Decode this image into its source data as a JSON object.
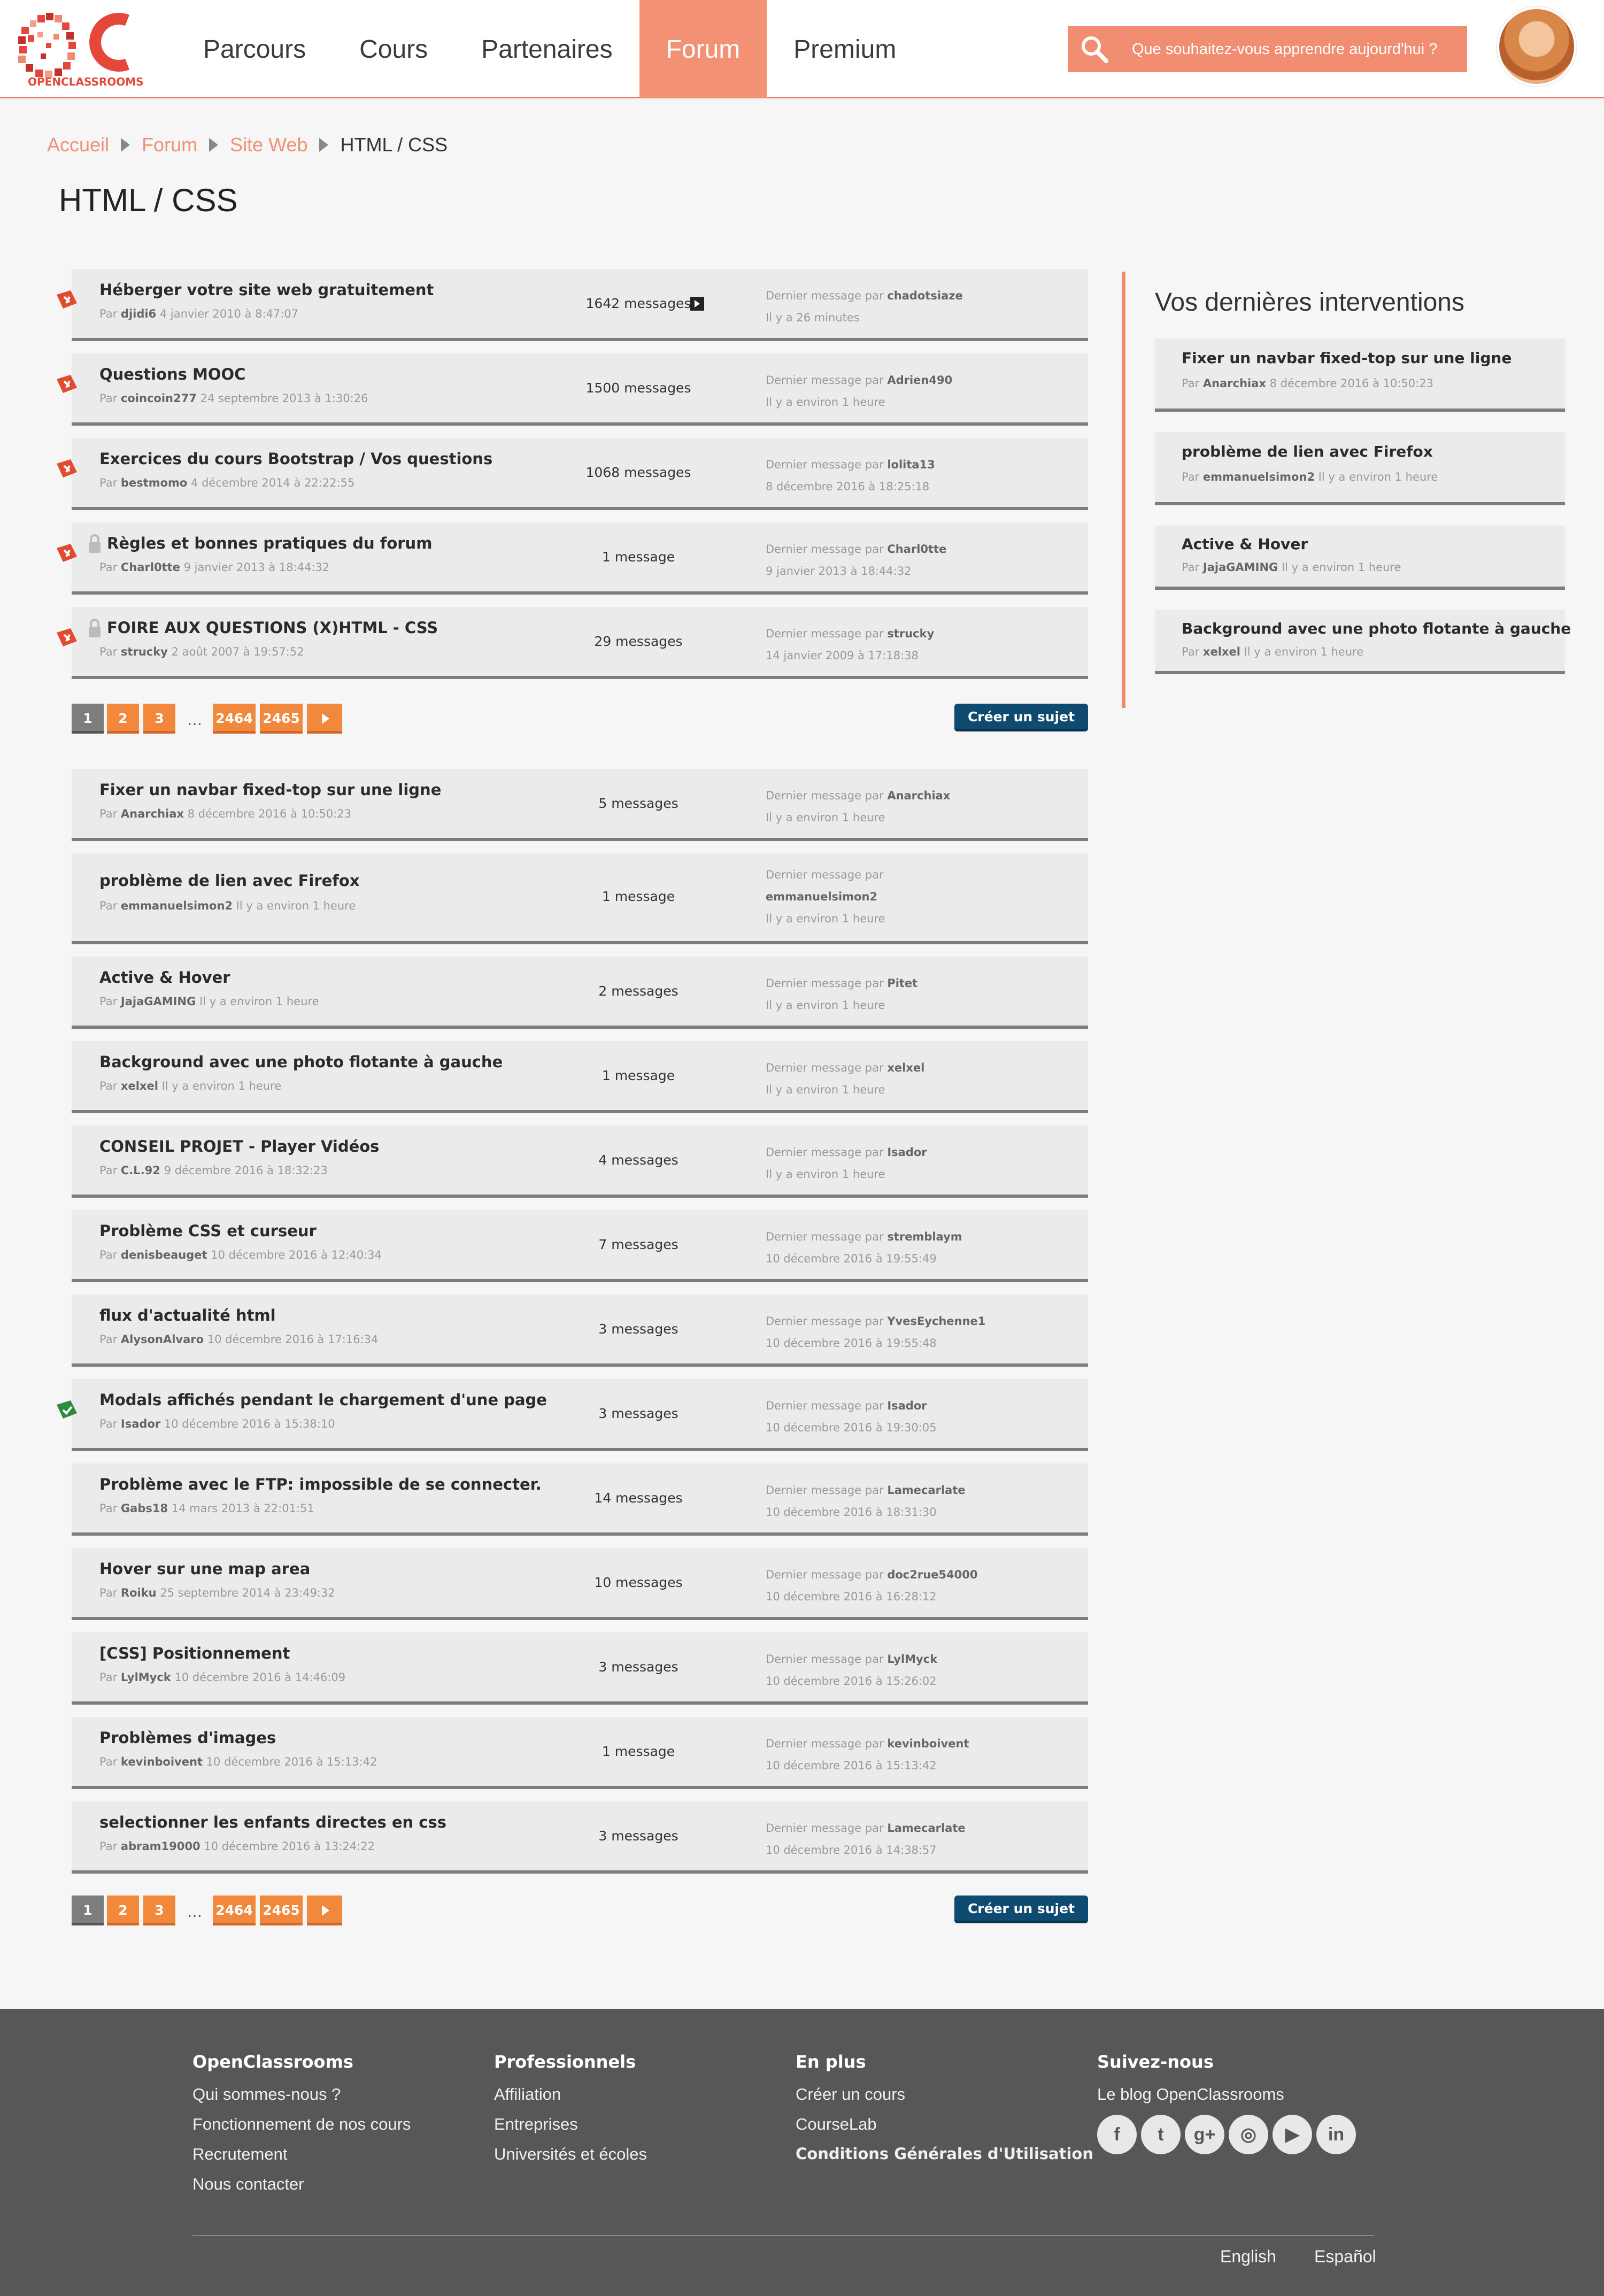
{
  "header": {
    "logo_text": "OPENCLASSROOMS",
    "nav": [
      {
        "label": "Parcours",
        "active": false
      },
      {
        "label": "Cours",
        "active": false
      },
      {
        "label": "Partenaires",
        "active": false
      },
      {
        "label": "Forum",
        "active": true
      },
      {
        "label": "Premium",
        "active": false
      }
    ],
    "search_placeholder": "Que souhaitez-vous apprendre aujourd'hui ?",
    "accent_color": "#f29173"
  },
  "breadcrumb": [
    "Accueil",
    "Forum",
    "Site Web",
    "HTML / CSS"
  ],
  "page_title": "HTML / CSS",
  "pinned_topics": [
    {
      "title": "Héberger votre site web gratuitement",
      "by": "djidi6",
      "date": "4 janvier 2010 à 8:47:07",
      "count": "1642 messages",
      "last_by": "chadotsiaze",
      "last_date": "Il y a 26 minutes",
      "badge": "pin",
      "locked": false
    },
    {
      "title": "Questions MOOC",
      "by": "coincoin277",
      "date": "24 septembre 2013 à 1:30:26",
      "count": "1500 messages",
      "last_by": "Adrien490",
      "last_date": "Il y a environ 1 heure",
      "badge": "pin",
      "locked": false
    },
    {
      "title": "Exercices du cours Bootstrap / Vos questions",
      "by": "bestmomo",
      "date": "4 décembre 2014 à 22:22:55",
      "count": "1068 messages",
      "last_by": "lolita13",
      "last_date": "8 décembre 2016 à 18:25:18",
      "badge": "pin",
      "locked": false
    },
    {
      "title": "Règles et bonnes pratiques du forum",
      "by": "Charl0tte",
      "date": "9 janvier 2013 à 18:44:32",
      "count": "1 message",
      "last_by": "Charl0tte",
      "last_date": "9 janvier 2013 à 18:44:32",
      "badge": "pin",
      "locked": true
    },
    {
      "title": "FOIRE AUX QUESTIONS (X)HTML - CSS",
      "by": "strucky",
      "date": "2 août 2007 à 19:57:52",
      "count": "29 messages",
      "last_by": "strucky",
      "last_date": "14 janvier 2009 à 17:18:38",
      "badge": "pin",
      "locked": true
    }
  ],
  "pagination": {
    "pages": [
      "1",
      "2",
      "3",
      "…",
      "2464",
      "2465"
    ],
    "current": "1"
  },
  "create_label": "Créer un sujet",
  "last_msg_prefix": "Dernier message par",
  "by_prefix": "Par",
  "topics": [
    {
      "title": "Fixer un navbar fixed-top sur une ligne",
      "by": "Anarchiax",
      "date": "8 décembre 2016 à 10:50:23",
      "count": "5 messages",
      "last_by": "Anarchiax",
      "last_date": "Il y a environ 1 heure"
    },
    {
      "title": "problème de lien avec Firefox",
      "by": "emmanuelsimon2",
      "date": "Il y a environ 1 heure",
      "count": "1 message",
      "last_by": "emmanuelsimon2",
      "last_date": "Il y a environ 1 heure"
    },
    {
      "title": "Active & Hover",
      "by": "JajaGAMING",
      "date": "Il y a environ 1 heure",
      "count": "2 messages",
      "last_by": "Pitet",
      "last_date": "Il y a environ 1 heure"
    },
    {
      "title": "Background avec une photo flotante à gauche",
      "by": "xelxel",
      "date": "Il y a environ 1 heure",
      "count": "1 message",
      "last_by": "xelxel",
      "last_date": "Il y a environ 1 heure"
    },
    {
      "title": "CONSEIL PROJET - Player Vidéos",
      "by": "C.L.92",
      "date": "9 décembre 2016 à 18:32:23",
      "count": "4 messages",
      "last_by": "Isador",
      "last_date": "Il y a environ 1 heure"
    },
    {
      "title": "Problème CSS et curseur",
      "by": "denisbeauget",
      "date": "10 décembre 2016 à 12:40:34",
      "count": "7 messages",
      "last_by": "stremblaym",
      "last_date": "10 décembre 2016 à 19:55:49"
    },
    {
      "title": "flux d'actualité html",
      "by": "AlysonAlvaro",
      "date": "10 décembre 2016 à 17:16:34",
      "count": "3 messages",
      "last_by": "YvesEychenne1",
      "last_date": "10 décembre 2016 à 19:55:48"
    },
    {
      "title": "Modals affichés pendant le chargement d'une page",
      "by": "Isador",
      "date": "10 décembre 2016 à 15:38:10",
      "count": "3 messages",
      "last_by": "Isador",
      "last_date": "10 décembre 2016 à 19:30:05",
      "resolved": true
    },
    {
      "title": "Problème avec le FTP: impossible de se connecter.",
      "by": "Gabs18",
      "date": "14 mars 2013 à 22:01:51",
      "count": "14 messages",
      "last_by": "Lamecarlate",
      "last_date": "10 décembre 2016 à 18:31:30"
    },
    {
      "title": "Hover sur une map area",
      "by": "Roiku",
      "date": "25 septembre 2014 à 23:49:32",
      "count": "10 messages",
      "last_by": "doc2rue54000",
      "last_date": "10 décembre 2016 à 16:28:12"
    },
    {
      "title": "[CSS] Positionnement",
      "by": "LylMyck",
      "date": "10 décembre 2016 à 14:46:09",
      "count": "3 messages",
      "last_by": "LylMyck",
      "last_date": "10 décembre 2016 à 15:26:02"
    },
    {
      "title": "Problèmes d'images",
      "by": "kevinboivent",
      "date": "10 décembre 2016 à 15:13:42",
      "count": "1 message",
      "last_by": "kevinboivent",
      "last_date": "10 décembre 2016 à 15:13:42"
    },
    {
      "title": "selectionner les enfants directes en css",
      "by": "abram19000",
      "date": "10 décembre 2016 à 13:24:22",
      "count": "3 messages",
      "last_by": "Lamecarlate",
      "last_date": "10 décembre 2016 à 14:38:57"
    }
  ],
  "sidebar": {
    "title": "Vos dernières interventions",
    "items": [
      {
        "title": "Fixer un navbar fixed-top sur une ligne",
        "by": "Anarchiax",
        "date": "8 décembre 2016 à 10:50:23"
      },
      {
        "title": "problème de lien avec Firefox",
        "by": "emmanuelsimon2",
        "date": "Il y a environ 1 heure"
      },
      {
        "title": "Active & Hover",
        "by": "JajaGAMING",
        "date": "Il y a environ 1 heure"
      },
      {
        "title": "Background avec une photo flotante à gauche",
        "by": "xelxel",
        "date": "Il y a environ 1 heure"
      }
    ]
  },
  "footer": {
    "columns": [
      {
        "title": "OpenClassrooms",
        "links": [
          "Qui sommes-nous ?",
          "Fonctionnement de nos cours",
          "Recrutement",
          "Nous contacter"
        ]
      },
      {
        "title": "Professionnels",
        "links": [
          "Affiliation",
          "Entreprises",
          "Universités et écoles"
        ]
      },
      {
        "title": "En plus",
        "links": [
          "Créer un cours",
          "CourseLab",
          "Conditions Générales d'Utilisation"
        ]
      },
      {
        "title": "Suivez-nous",
        "links": [
          "Le blog OpenClassrooms"
        ]
      }
    ],
    "socials": [
      "facebook-icon",
      "twitter-icon",
      "googleplus-icon",
      "instagram-icon",
      "youtube-icon",
      "linkedin-icon"
    ],
    "languages": [
      "English",
      "Español"
    ]
  }
}
